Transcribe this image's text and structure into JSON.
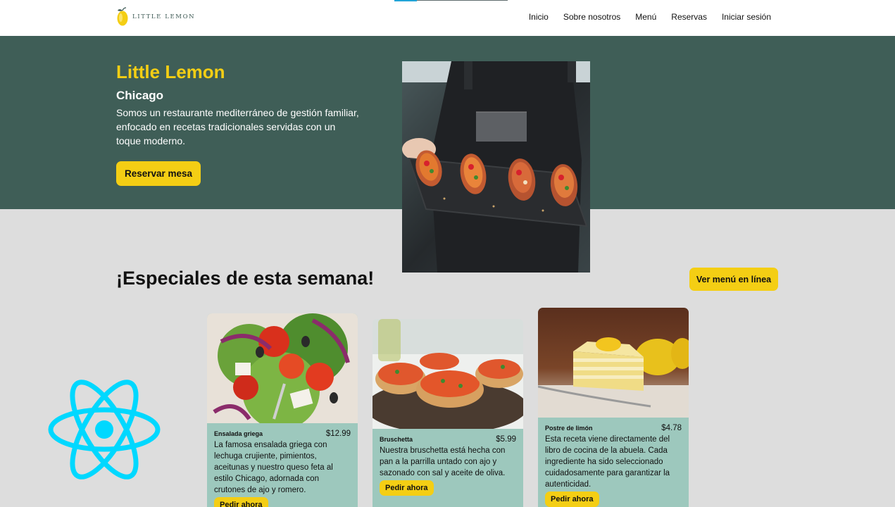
{
  "header": {
    "logo_text": "Little Lemon",
    "nav": [
      "Inicio",
      "Sobre nosotros",
      "Menú",
      "Reservas",
      "Iniciar sesión"
    ]
  },
  "hero": {
    "title": "Little Lemon",
    "city": "Chicago",
    "description": "Somos un restaurante mediterráneo de gestión familiar, enfocado en recetas tradicionales servidas con un toque moderno.",
    "cta": "Reservar mesa"
  },
  "specials": {
    "title": "¡Especiales de esta semana!",
    "menu_button": "Ver menú en línea",
    "items": [
      {
        "name": "Ensalada griega",
        "price": "$12.99",
        "description": "La famosa ensalada griega con lechuga crujiente, pimientos, aceitunas y nuestro queso feta al estilo Chicago, adornada con crutones de ajo y romero.",
        "order": "Pedir ahora"
      },
      {
        "name": "Bruschetta",
        "price": "$5.99",
        "description": "Nuestra bruschetta está hecha con pan a la parrilla untado con ajo y sazonado con sal y aceite de oliva.",
        "order": "Pedir ahora"
      },
      {
        "name": "Postre de limón",
        "price": "$4.78",
        "description": "Esta receta viene directamente del libro de cocina de la abuela. Cada ingrediente ha sido seleccionado cuidadosamente para garantizar la autenticidad.",
        "order": "Pedir ahora"
      }
    ]
  },
  "colors": {
    "primary_green": "#3f5e57",
    "primary_yellow": "#f4ce14",
    "card_bg": "#9dc8bd",
    "page_bg": "#dddddd",
    "react_blue": "#00d8ff"
  }
}
